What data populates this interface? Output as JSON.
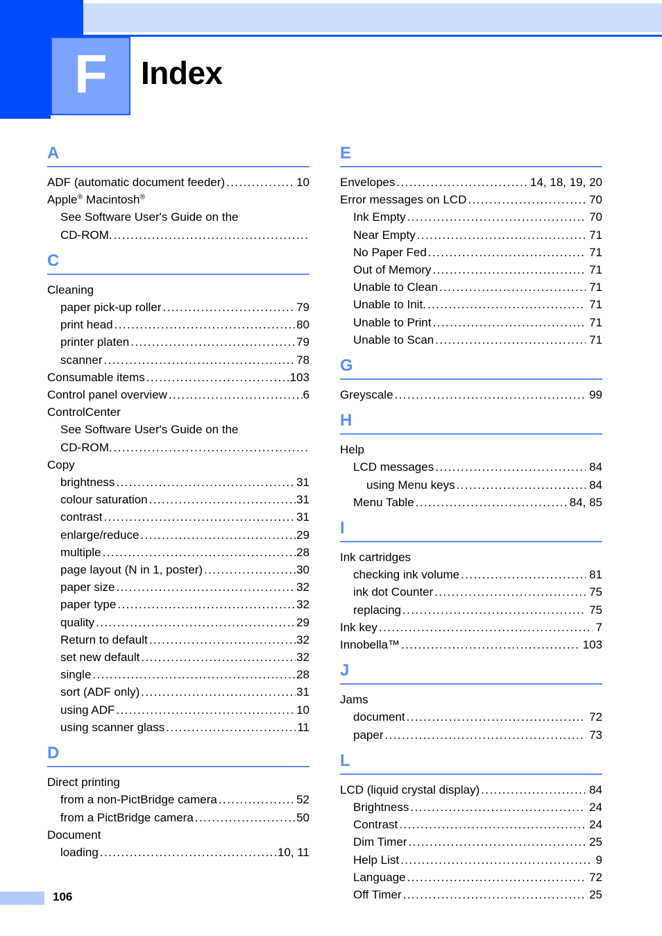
{
  "chapter": {
    "badge_letter": "F",
    "title": "Index"
  },
  "colors": {
    "dark_blue": "#004bfd",
    "light_blue_bar": "#ccdcfd",
    "badge_blue": "#7ca4fd",
    "section_letter_blue": "#5b8ef7",
    "footer_swatch": "#b3caf9"
  },
  "footer": {
    "page_number": "106"
  },
  "columns": [
    {
      "id": "left",
      "sections": [
        {
          "letter": "A",
          "entries": [
            {
              "level": 1,
              "label": "ADF (automatic document feeder)",
              "page": "10"
            },
            {
              "level": 1,
              "label": "Apple® Macintosh®",
              "html": "Apple<sup>®</sup> Macintosh<sup>®</sup>",
              "page": ""
            },
            {
              "level": 2,
              "label": "See Software User's Guide on the",
              "page": ""
            },
            {
              "level": 2,
              "label": "CD-ROM.",
              "page": ""
            }
          ]
        },
        {
          "letter": "C",
          "entries": [
            {
              "level": 1,
              "label": "Cleaning",
              "page": ""
            },
            {
              "level": 2,
              "label": "paper pick-up roller",
              "page": "79"
            },
            {
              "level": 2,
              "label": "print head",
              "page": "80"
            },
            {
              "level": 2,
              "label": "printer platen",
              "page": "79"
            },
            {
              "level": 2,
              "label": "scanner",
              "page": "78"
            },
            {
              "level": 1,
              "label": "Consumable items",
              "page": "103"
            },
            {
              "level": 1,
              "label": "Control panel overview",
              "page": "6"
            },
            {
              "level": 1,
              "label": "ControlCenter",
              "page": ""
            },
            {
              "level": 2,
              "label": "See Software User's Guide on the",
              "page": ""
            },
            {
              "level": 2,
              "label": "CD-ROM.",
              "page": ""
            },
            {
              "level": 1,
              "label": "Copy",
              "page": ""
            },
            {
              "level": 2,
              "label": "brightness",
              "page": "31"
            },
            {
              "level": 2,
              "label": "colour saturation",
              "page": "31"
            },
            {
              "level": 2,
              "label": "contrast",
              "page": "31"
            },
            {
              "level": 2,
              "label": "enlarge/reduce",
              "page": "29"
            },
            {
              "level": 2,
              "label": "multiple",
              "page": "28"
            },
            {
              "level": 2,
              "label": "page layout (N in 1, poster)",
              "page": "30"
            },
            {
              "level": 2,
              "label": "paper size",
              "page": "32"
            },
            {
              "level": 2,
              "label": "paper type",
              "page": "32"
            },
            {
              "level": 2,
              "label": "quality",
              "page": "29"
            },
            {
              "level": 2,
              "label": "Return to default",
              "page": "32"
            },
            {
              "level": 2,
              "label": "set new default",
              "page": "32"
            },
            {
              "level": 2,
              "label": "single",
              "page": "28"
            },
            {
              "level": 2,
              "label": "sort (ADF only)",
              "page": "31"
            },
            {
              "level": 2,
              "label": "using ADF",
              "page": "10"
            },
            {
              "level": 2,
              "label": "using scanner glass",
              "page": "11"
            }
          ]
        },
        {
          "letter": "D",
          "entries": [
            {
              "level": 1,
              "label": "Direct printing",
              "page": ""
            },
            {
              "level": 2,
              "label": "from a non-PictBridge camera",
              "page": "52"
            },
            {
              "level": 2,
              "label": "from a PictBridge camera",
              "page": "50"
            },
            {
              "level": 1,
              "label": "Document",
              "page": ""
            },
            {
              "level": 2,
              "label": "loading",
              "page": "10, 11"
            }
          ]
        }
      ]
    },
    {
      "id": "right",
      "sections": [
        {
          "letter": "E",
          "entries": [
            {
              "level": 1,
              "label": "Envelopes",
              "page": "14, 18, 19, 20"
            },
            {
              "level": 1,
              "label": "Error messages on LCD",
              "page": "70"
            },
            {
              "level": 2,
              "label": "Ink Empty",
              "page": "70"
            },
            {
              "level": 2,
              "label": "Near Empty",
              "page": "71"
            },
            {
              "level": 2,
              "label": "No Paper Fed",
              "page": "71"
            },
            {
              "level": 2,
              "label": "Out of Memory",
              "page": "71"
            },
            {
              "level": 2,
              "label": "Unable to Clean",
              "page": "71"
            },
            {
              "level": 2,
              "label": "Unable to Init.",
              "page": "71"
            },
            {
              "level": 2,
              "label": "Unable to Print",
              "page": "71"
            },
            {
              "level": 2,
              "label": "Unable to Scan",
              "page": "71"
            }
          ]
        },
        {
          "letter": "G",
          "entries": [
            {
              "level": 1,
              "label": "Greyscale",
              "page": "99"
            }
          ]
        },
        {
          "letter": "H",
          "entries": [
            {
              "level": 1,
              "label": "Help",
              "page": ""
            },
            {
              "level": 2,
              "label": "LCD messages",
              "page": "84"
            },
            {
              "level": 3,
              "label": "using Menu keys",
              "page": "84"
            },
            {
              "level": 2,
              "label": "Menu Table",
              "page": "84, 85"
            }
          ]
        },
        {
          "letter": "I",
          "entries": [
            {
              "level": 1,
              "label": "Ink cartridges",
              "page": ""
            },
            {
              "level": 2,
              "label": "checking ink volume",
              "page": "81"
            },
            {
              "level": 2,
              "label": "ink dot Counter",
              "page": "75"
            },
            {
              "level": 2,
              "label": "replacing",
              "page": "75"
            },
            {
              "level": 1,
              "label": "Ink key",
              "page": "7"
            },
            {
              "level": 1,
              "label": "Innobella™",
              "html": "Innobella™",
              "page": "103"
            }
          ]
        },
        {
          "letter": "J",
          "entries": [
            {
              "level": 1,
              "label": "Jams",
              "page": ""
            },
            {
              "level": 2,
              "label": "document",
              "page": "72"
            },
            {
              "level": 2,
              "label": "paper",
              "page": "73"
            }
          ]
        },
        {
          "letter": "L",
          "entries": [
            {
              "level": 1,
              "label": "LCD (liquid crystal display)",
              "page": "84"
            },
            {
              "level": 2,
              "label": "Brightness",
              "page": "24"
            },
            {
              "level": 2,
              "label": "Contrast",
              "page": "24"
            },
            {
              "level": 2,
              "label": "Dim Timer",
              "page": "25"
            },
            {
              "level": 2,
              "label": "Help List",
              "page": "9"
            },
            {
              "level": 2,
              "label": "Language",
              "page": "72"
            },
            {
              "level": 2,
              "label": "Off Timer",
              "page": "25"
            }
          ]
        }
      ]
    }
  ]
}
